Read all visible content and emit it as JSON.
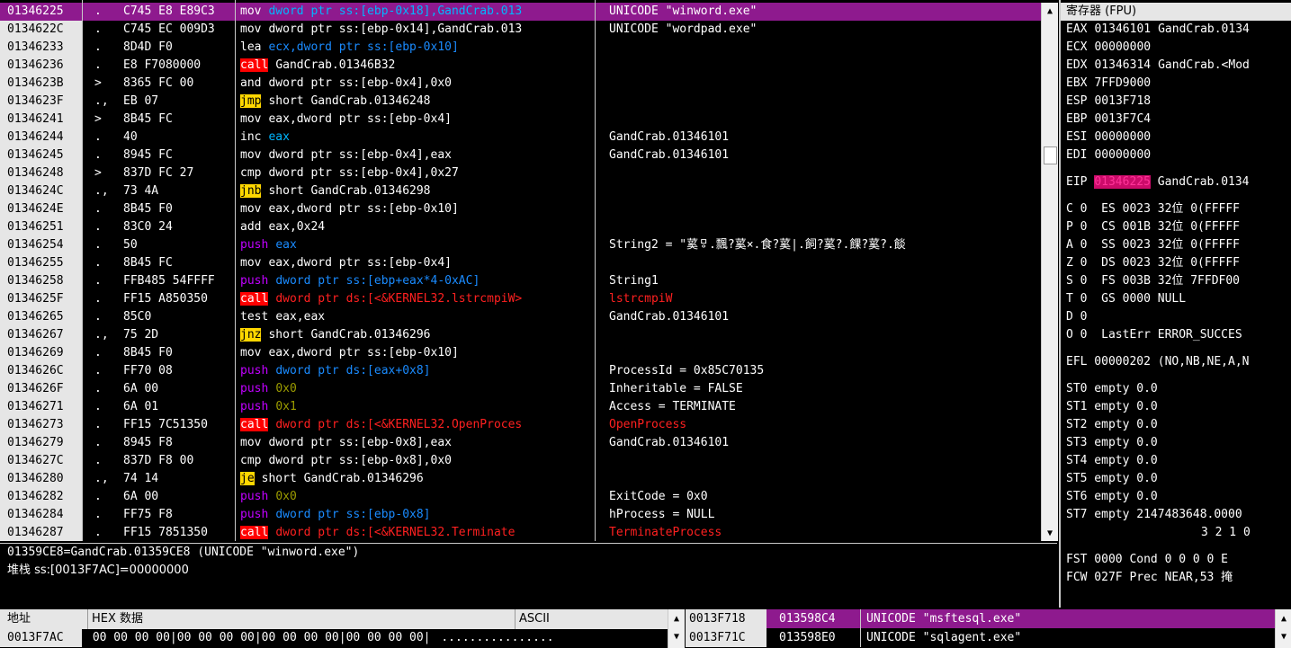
{
  "disasm": {
    "rows": [
      {
        "addr": "01346225",
        "marker": ".",
        "hex": "C745 E8 E89C3",
        "mn": "mov",
        "op": "dword ptr ss:[ebp-0x18],GandCrab.013",
        "comment": "UNICODE \"winword.exe\"",
        "selected": true
      },
      {
        "addr": "0134622C",
        "marker": ".",
        "hex": "C745 EC 009D3",
        "mn": "mov",
        "op": "dword ptr ss:[ebp-0x14],GandCrab.013",
        "comment": "UNICODE \"wordpad.exe\""
      },
      {
        "addr": "01346233",
        "marker": ".",
        "hex": "8D4D F0",
        "mn": "lea",
        "op": "ecx,dword ptr ss:[ebp-0x10]",
        "comment": ""
      },
      {
        "addr": "01346236",
        "marker": ".",
        "hex": "E8 F7080000",
        "mn": "call",
        "op": "GandCrab.01346B32",
        "comment": ""
      },
      {
        "addr": "0134623B",
        "marker": ">",
        "hex": "8365 FC 00",
        "mn": "and",
        "op": "dword ptr ss:[ebp-0x4],0x0",
        "comment": ""
      },
      {
        "addr": "0134623F",
        "marker": ".,",
        "hex": "EB 07",
        "mn": "jmp",
        "op": "short GandCrab.01346248",
        "comment": ""
      },
      {
        "addr": "01346241",
        "marker": ">",
        "hex": "8B45 FC",
        "mn": "mov",
        "op": "eax,dword ptr ss:[ebp-0x4]",
        "comment": ""
      },
      {
        "addr": "01346244",
        "marker": ".",
        "hex": "40",
        "mn": "inc",
        "op": "eax",
        "comment": "GandCrab.01346101"
      },
      {
        "addr": "01346245",
        "marker": ".",
        "hex": "8945 FC",
        "mn": "mov",
        "op": "dword ptr ss:[ebp-0x4],eax",
        "comment": "GandCrab.01346101"
      },
      {
        "addr": "01346248",
        "marker": ">",
        "hex": "837D FC 27",
        "mn": "cmp",
        "op": "dword ptr ss:[ebp-0x4],0x27",
        "comment": ""
      },
      {
        "addr": "0134624C",
        "marker": ".,",
        "hex": "73 4A",
        "mn": "jnb",
        "op": "short GandCrab.01346298",
        "comment": ""
      },
      {
        "addr": "0134624E",
        "marker": ".",
        "hex": "8B45 F0",
        "mn": "mov",
        "op": "eax,dword ptr ss:[ebp-0x10]",
        "comment": ""
      },
      {
        "addr": "01346251",
        "marker": ".",
        "hex": "83C0 24",
        "mn": "add",
        "op": "eax,0x24",
        "comment": ""
      },
      {
        "addr": "01346254",
        "marker": ".",
        "hex": "50",
        "mn": "push",
        "op": "eax",
        "comment": "String2 = \"蒵ㅱ.飄?蒵×.食?蒵|.飼?蒵?.餜?蒵?.餤"
      },
      {
        "addr": "01346255",
        "marker": ".",
        "hex": "8B45 FC",
        "mn": "mov",
        "op": "eax,dword ptr ss:[ebp-0x4]",
        "comment": ""
      },
      {
        "addr": "01346258",
        "marker": ".",
        "hex": "FFB485 54FFFF",
        "mn": "push",
        "op": "dword ptr ss:[ebp+eax*4-0xAC]",
        "comment": "String1"
      },
      {
        "addr": "0134625F",
        "marker": ".",
        "hex": "FF15 A850350",
        "mn": "call",
        "op": "dword ptr ds:[<&KERNEL32.lstrcmpiW>",
        "comment": "lstrcmpiW"
      },
      {
        "addr": "01346265",
        "marker": ".",
        "hex": "85C0",
        "mn": "test",
        "op": "eax,eax",
        "comment": "GandCrab.01346101"
      },
      {
        "addr": "01346267",
        "marker": ".,",
        "hex": "75 2D",
        "mn": "jnz",
        "op": "short GandCrab.01346296",
        "comment": ""
      },
      {
        "addr": "01346269",
        "marker": ".",
        "hex": "8B45 F0",
        "mn": "mov",
        "op": "eax,dword ptr ss:[ebp-0x10]",
        "comment": ""
      },
      {
        "addr": "0134626C",
        "marker": ".",
        "hex": "FF70 08",
        "mn": "push",
        "op": "dword ptr ds:[eax+0x8]",
        "comment": "ProcessId = 0x85C70135"
      },
      {
        "addr": "0134626F",
        "marker": ".",
        "hex": "6A 00",
        "mn": "push",
        "op": "0x0",
        "comment": "Inheritable = FALSE"
      },
      {
        "addr": "01346271",
        "marker": ".",
        "hex": "6A 01",
        "mn": "push",
        "op": "0x1",
        "comment": "Access = TERMINATE"
      },
      {
        "addr": "01346273",
        "marker": ".",
        "hex": "FF15 7C51350",
        "mn": "call",
        "op": "dword ptr ds:[<&KERNEL32.OpenProces",
        "comment": "OpenProcess"
      },
      {
        "addr": "01346279",
        "marker": ".",
        "hex": "8945 F8",
        "mn": "mov",
        "op": "dword ptr ss:[ebp-0x8],eax",
        "comment": "GandCrab.01346101"
      },
      {
        "addr": "0134627C",
        "marker": ".",
        "hex": "837D F8 00",
        "mn": "cmp",
        "op": "dword ptr ss:[ebp-0x8],0x0",
        "comment": ""
      },
      {
        "addr": "01346280",
        "marker": ".,",
        "hex": "74 14",
        "mn": "je",
        "op": "short GandCrab.01346296",
        "comment": ""
      },
      {
        "addr": "01346282",
        "marker": ".",
        "hex": "6A 00",
        "mn": "push",
        "op": "0x0",
        "comment": "ExitCode = 0x0"
      },
      {
        "addr": "01346284",
        "marker": ".",
        "hex": "FF75 F8",
        "mn": "push",
        "op": "dword ptr ss:[ebp-0x8]",
        "comment": "hProcess = NULL"
      },
      {
        "addr": "01346287",
        "marker": ".",
        "hex": "FF15 7851350",
        "mn": "call",
        "op": "dword ptr ds:[<&KERNEL32.Terminate",
        "comment": "TerminateProcess"
      }
    ]
  },
  "info": {
    "line1": "01359CE8=GandCrab.01359CE8 (UNICODE \"winword.exe\")",
    "line2": "堆栈 ss:[0013F7AC]=00000000"
  },
  "registers": {
    "title": "寄存器 (FPU)",
    "gp": [
      {
        "name": "EAX",
        "value": "01346101",
        "comment": "GandCrab.0134"
      },
      {
        "name": "ECX",
        "value": "00000000",
        "comment": ""
      },
      {
        "name": "EDX",
        "value": "01346314",
        "comment": "GandCrab.<Mod"
      },
      {
        "name": "EBX",
        "value": "7FFD9000",
        "comment": ""
      },
      {
        "name": "ESP",
        "value": "0013F718",
        "comment": ""
      },
      {
        "name": "EBP",
        "value": "0013F7C4",
        "comment": ""
      },
      {
        "name": "ESI",
        "value": "00000000",
        "comment": ""
      },
      {
        "name": "EDI",
        "value": "00000000",
        "comment": ""
      }
    ],
    "eip": {
      "name": "EIP",
      "value": "01346225",
      "comment": "GandCrab.0134"
    },
    "flags": [
      "C 0  ES 0023 32位 0(FFFFF",
      "P 0  CS 001B 32位 0(FFFFF",
      "A 0  SS 0023 32位 0(FFFFF",
      "Z 0  DS 0023 32位 0(FFFFF",
      "S 0  FS 003B 32位 7FFDF00",
      "T 0  GS 0000 NULL",
      "D 0",
      "O 0  LastErr ERROR_SUCCES"
    ],
    "efl": "EFL 00000202 (NO,NB,NE,A,N",
    "fpu": [
      "ST0 empty 0.0",
      "ST1 empty 0.0",
      "ST2 empty 0.0",
      "ST3 empty 0.0",
      "ST4 empty 0.0",
      "ST5 empty 0.0",
      "ST6 empty 0.0",
      "ST7 empty 2147483648.0000"
    ],
    "bits": "3 2 1 0",
    "fst": "FST 0000  Cond 0 0 0 0  E",
    "fcw": "FCW 027F  Prec NEAR,53  掩"
  },
  "dump": {
    "headers": {
      "addr": "地址",
      "hex": "HEX 数据",
      "ascii": "ASCII"
    },
    "row": {
      "addr": "0013F7AC",
      "hex": "00 00 00 00|00 00 00 00|00 00 00 00|00 00 00 00|",
      "ascii": "................"
    }
  },
  "stack": {
    "rows": [
      {
        "addr": "0013F718",
        "value": "013598C4",
        "comment": "UNICODE \"msftesql.exe\"",
        "selected": true
      },
      {
        "addr": "0013F71C",
        "value": "013598E0",
        "comment": "UNICODE \"sqlagent.exe\""
      }
    ]
  },
  "colors": {
    "selection": "#8e1a8e",
    "call_bg": "#ff0000",
    "jump_bg": "#ffd700",
    "push_fg": "#c000ff",
    "register_fg": "#00b7ff"
  },
  "icons": {
    "scroll_up": "triangle-up-icon",
    "scroll_down": "triangle-down-icon"
  }
}
